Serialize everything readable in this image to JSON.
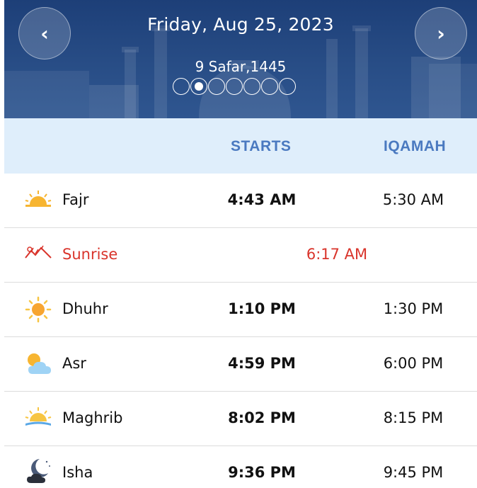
{
  "header": {
    "date": "Friday, Aug 25, 2023",
    "hijri": "9 Safar,1445",
    "prev_label": "‹",
    "next_label": "›",
    "pager": {
      "count": 7,
      "active_index": 1
    }
  },
  "columns": {
    "starts": "STARTS",
    "iqamah": "IQAMAH"
  },
  "prayers": [
    {
      "name": "Fajr",
      "starts": "4:43 AM",
      "iqamah": "5:30 AM",
      "icon": "sunrise-horizon-icon"
    },
    {
      "name": "Sunrise",
      "time": "6:17 AM",
      "icon": "sunrise-mountain-icon"
    },
    {
      "name": "Dhuhr",
      "starts": "1:10 PM",
      "iqamah": "1:30 PM",
      "icon": "sun-icon"
    },
    {
      "name": "Asr",
      "starts": "4:59 PM",
      "iqamah": "6:00 PM",
      "icon": "sun-cloud-icon"
    },
    {
      "name": "Maghrib",
      "starts": "8:02 PM",
      "iqamah": "8:15 PM",
      "icon": "sunset-icon"
    },
    {
      "name": "Isha",
      "starts": "9:36 PM",
      "iqamah": "9:45 PM",
      "icon": "moon-cloud-icon"
    }
  ],
  "colors": {
    "header_bg": "#284d86",
    "column_bar_bg": "#dfeefb",
    "column_label": "#4a79c0",
    "sunrise_text": "#d9342b"
  }
}
